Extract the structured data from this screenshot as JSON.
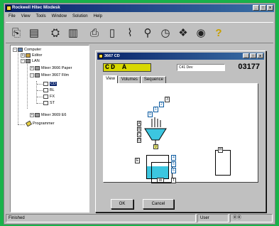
{
  "app": {
    "title": "Rockwell Hitec Mixdesk"
  },
  "window_buttons": [
    "_",
    "□",
    "x"
  ],
  "menu": [
    "File",
    "View",
    "Tools",
    "Window",
    "Solution",
    "Help"
  ],
  "toolbar_icons": [
    "open-icon",
    "save-icon",
    "binoculars-icon",
    "printer-icon",
    "graph-icon",
    "chart-icon",
    "wrench-icon",
    "clock-icon",
    "network-icon",
    "globe-icon",
    "help-icon"
  ],
  "toolbar_glyphs": [
    "⎘",
    "▤",
    "⛭",
    "▥",
    "⎙",
    "▯",
    "⌇",
    "⚲",
    "◷",
    "❖",
    "◉",
    "?"
  ],
  "tree": {
    "computer": "Computer",
    "editor": "Editor",
    "lan": "LAN",
    "mixer1": "Mixer 3666 Paper",
    "mixer2": "Mixer 3667 Film",
    "ch_cd": "CD",
    "ch_bl": "BL",
    "ch_fx": "FX",
    "ch_st": "ST",
    "mixer3": "Mixer 3669 E6",
    "programmer": "Programmer"
  },
  "child": {
    "title": "3667 CD",
    "channel": "CD A",
    "description": "C41 Dev",
    "number": "03177"
  },
  "tabs": [
    "View",
    "Volumes",
    "Sequence"
  ],
  "diagram": {
    "stairs": [
      "0",
      "1",
      "2",
      "3"
    ],
    "letters": [
      "A",
      "B",
      "C",
      "D"
    ],
    "v": "V",
    "e": "E",
    "r_nums": [
      "4",
      "5",
      "6"
    ],
    "w": "W",
    "t": "T",
    "h": "H"
  },
  "buttons": {
    "ok": "OK",
    "cancel": "Cancel"
  },
  "status": {
    "message": "Finished",
    "user": "User",
    "kbd": "ⓀⓀ"
  },
  "colors": {
    "accent": "#0a246a",
    "fill": "#3cc6e0",
    "highlight": "#d8d800"
  }
}
